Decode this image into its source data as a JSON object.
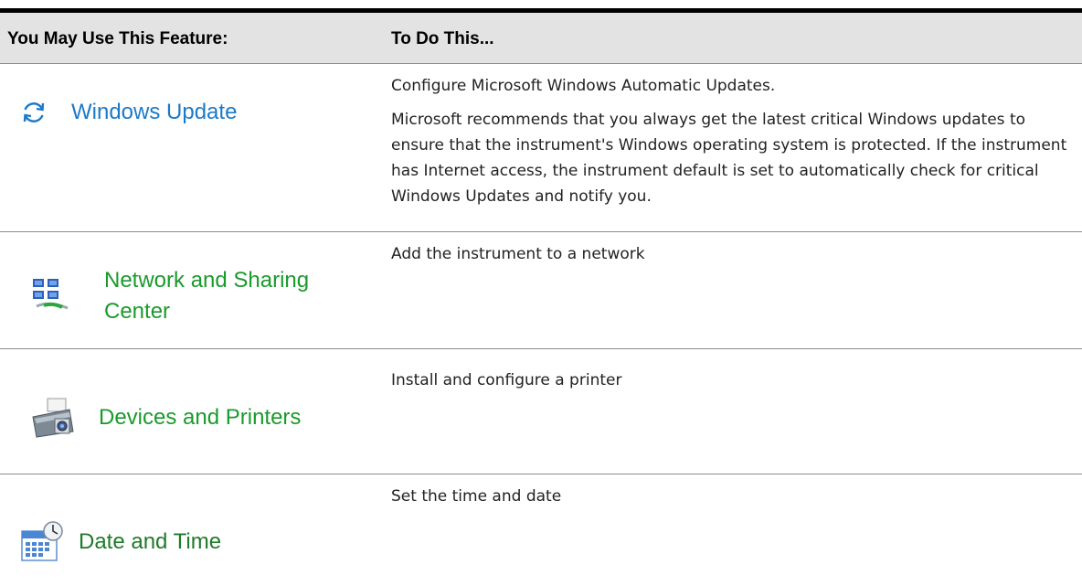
{
  "header": {
    "col1": "You May Use This Feature:",
    "col2": "To Do This..."
  },
  "colors": {
    "link_blue": "#1c79c8",
    "link_green": "#1a9a2c",
    "header_bg": "#e3e3e3",
    "rule": "#8d8d8d"
  },
  "rows": [
    {
      "icon": "refresh-icon",
      "feature": [
        "Windows Update"
      ],
      "description": [
        "Configure Microsoft Windows Automatic Updates.",
        "Microsoft recommends that you always get the latest critical Windows updates to ensure that the instrument's Windows operating system is protected. If the instrument has Internet access, the instrument default is set to automatically check for critical Windows Updates and notify you."
      ]
    },
    {
      "icon": "network-icon",
      "feature": [
        "Network and Sharing",
        "Center"
      ],
      "description": [
        "Add the instrument to a network"
      ]
    },
    {
      "icon": "printer-icon",
      "feature": [
        "Devices and Printers"
      ],
      "description": [
        "Install and configure a printer"
      ]
    },
    {
      "icon": "calendar-clock-icon",
      "feature": [
        "Date and Time"
      ],
      "description": [
        "Set the time and date"
      ]
    }
  ]
}
